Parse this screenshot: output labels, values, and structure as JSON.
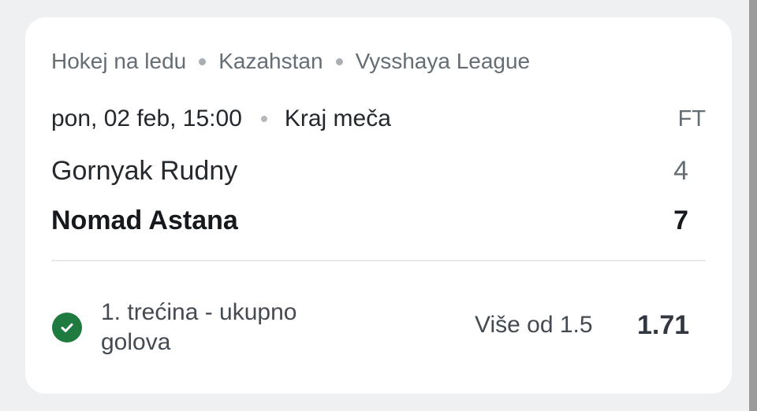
{
  "colors": {
    "page_background": "#eef0f2",
    "card_background": "#ffffff",
    "muted_text": "#656d75",
    "success_green": "#1f7a3f"
  },
  "breadcrumb": {
    "sport": "Hokej na ledu",
    "country": "Kazahstan",
    "league": "Vysshaya League"
  },
  "match": {
    "datetime": "pon, 02 feb, 15:00",
    "status_text": "Kraj meča",
    "status_short": "FT",
    "home_team": "Gornyak Rudny",
    "home_score": "4",
    "away_team": "Nomad Astana",
    "away_score": "7",
    "winner": "away"
  },
  "bet": {
    "result_icon": "check-circle-icon",
    "result": "won",
    "market": "1. trećina - ukupno golova",
    "pick": "Više od 1.5",
    "odds": "1.71"
  }
}
